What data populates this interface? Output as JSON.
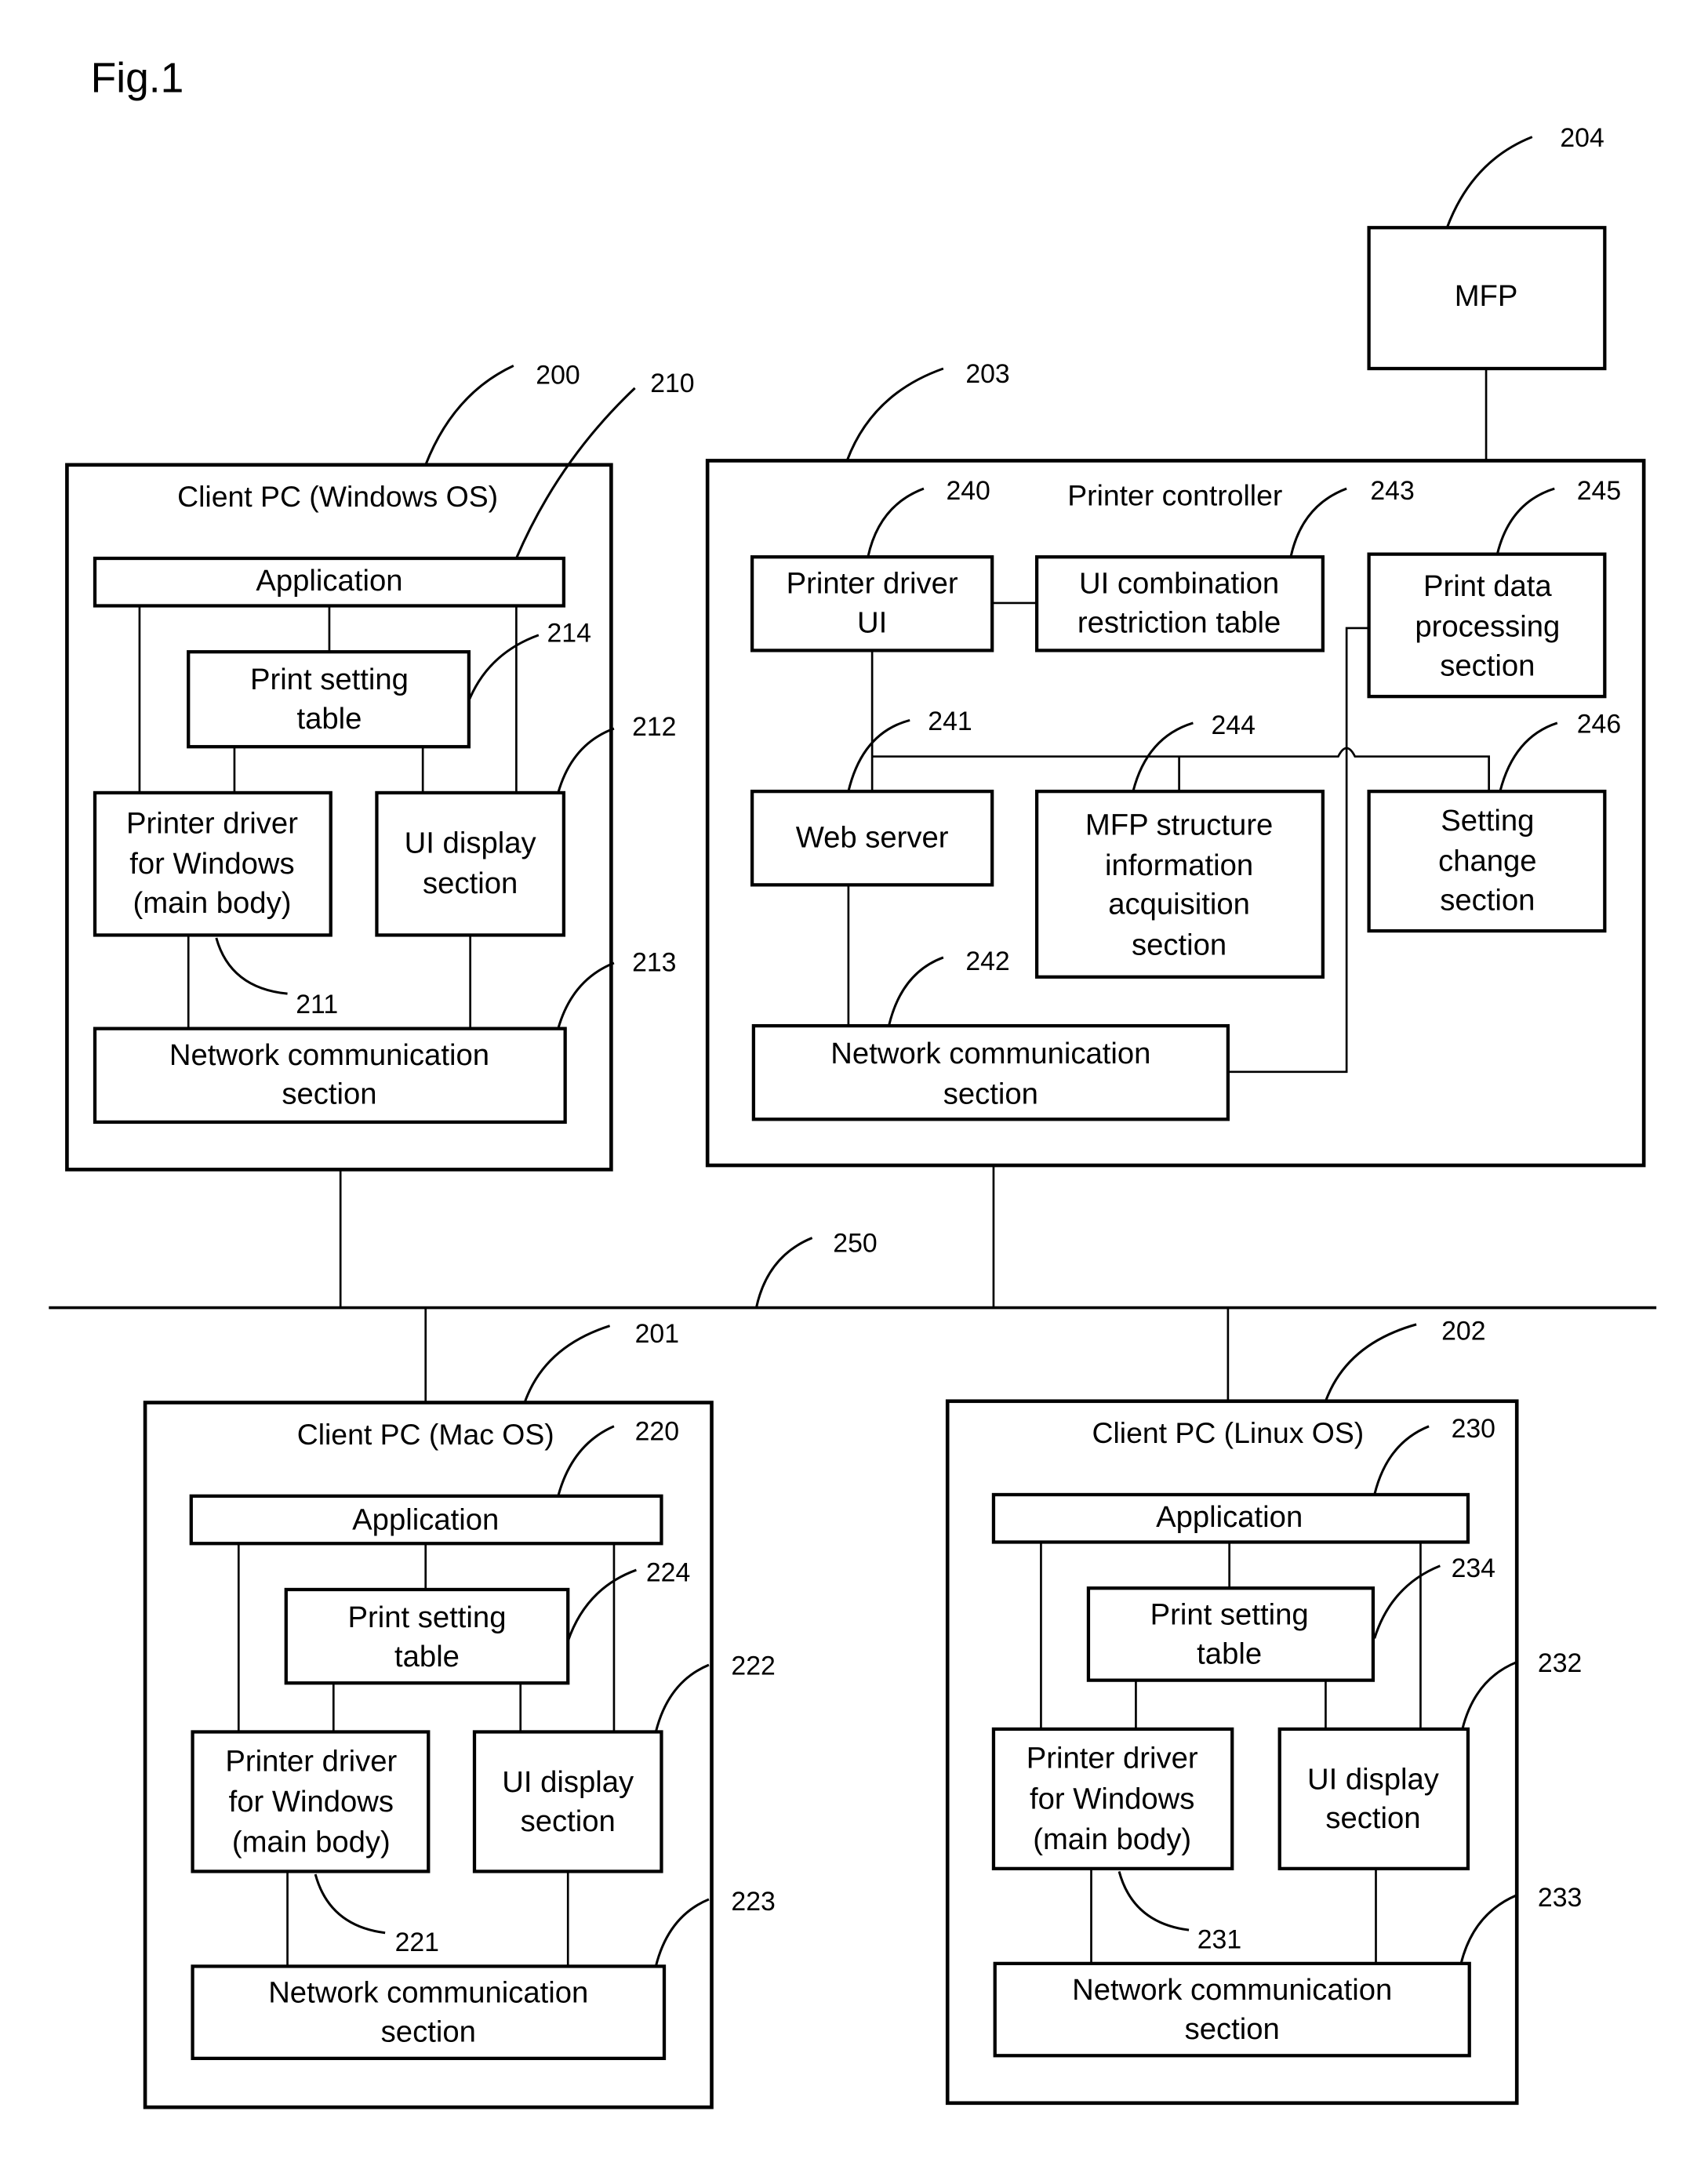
{
  "figure": {
    "label": "Fig.1"
  },
  "mfp": {
    "ref": "204",
    "label": "MFP"
  },
  "network": {
    "ref": "250"
  },
  "client_windows": {
    "ref": "200",
    "title": "Client PC (Windows OS)",
    "application": {
      "ref": "210",
      "label": "Application"
    },
    "print_setting_table": {
      "ref": "214",
      "lines": [
        "Print setting",
        "table"
      ]
    },
    "printer_driver": {
      "ref": "211",
      "lines": [
        "Printer driver",
        "for Windows",
        "(main body)"
      ]
    },
    "ui_display": {
      "ref": "212",
      "lines": [
        "UI display",
        "section"
      ]
    },
    "network_comm": {
      "ref": "213",
      "lines": [
        "Network communication",
        "section"
      ]
    }
  },
  "printer_controller": {
    "ref": "203",
    "title": "Printer controller",
    "printer_driver_ui": {
      "ref": "240",
      "lines": [
        "Printer driver",
        "UI"
      ]
    },
    "ui_combination_table": {
      "ref": "243",
      "lines": [
        "UI combination",
        "restriction table"
      ]
    },
    "print_data_processing": {
      "ref": "245",
      "lines": [
        "Print data",
        "processing",
        "section"
      ]
    },
    "web_server": {
      "ref": "241",
      "lines": [
        "Web server"
      ]
    },
    "mfp_structure": {
      "ref": "244",
      "lines": [
        "MFP structure",
        "information",
        "acquisition",
        "section"
      ]
    },
    "setting_change": {
      "ref": "246",
      "lines": [
        "Setting",
        "change",
        "section"
      ]
    },
    "network_comm": {
      "ref": "242",
      "lines": [
        "Network communication",
        "section"
      ]
    }
  },
  "client_mac": {
    "ref": "201",
    "title": "Client PC (Mac OS)",
    "application": {
      "ref": "220",
      "label": "Application"
    },
    "print_setting_table": {
      "ref": "224",
      "lines": [
        "Print setting",
        "table"
      ]
    },
    "printer_driver": {
      "ref": "221",
      "lines": [
        "Printer driver",
        "for Windows",
        "(main body)"
      ]
    },
    "ui_display": {
      "ref": "222",
      "lines": [
        "UI display",
        "section"
      ]
    },
    "network_comm": {
      "ref": "223",
      "lines": [
        "Network communication",
        "section"
      ]
    }
  },
  "client_linux": {
    "ref": "202",
    "title": "Client PC (Linux OS)",
    "application": {
      "ref": "230",
      "label": "Application"
    },
    "print_setting_table": {
      "ref": "234",
      "lines": [
        "Print setting",
        "table"
      ]
    },
    "printer_driver": {
      "ref": "231",
      "lines": [
        "Printer driver",
        "for Windows",
        "(main body)"
      ]
    },
    "ui_display": {
      "ref": "232",
      "lines": [
        "UI display",
        "section"
      ]
    },
    "network_comm": {
      "ref": "233",
      "lines": [
        "Network communication",
        "section"
      ]
    }
  }
}
